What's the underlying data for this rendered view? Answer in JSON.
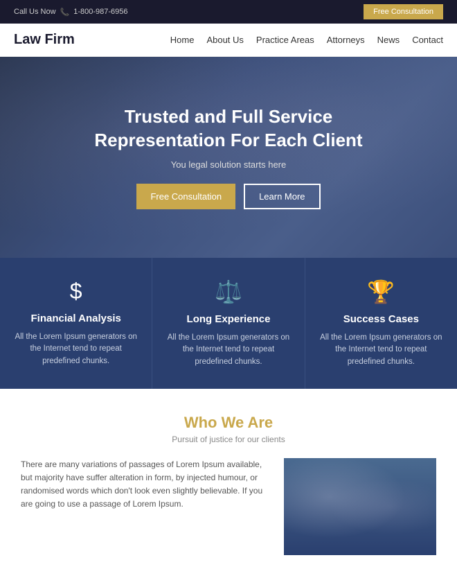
{
  "topbar": {
    "call_label": "Call Us Now",
    "phone": "1-800-987-6956",
    "cta_button": "Free Consultation"
  },
  "nav": {
    "logo": "Law Firm",
    "links": [
      {
        "label": "Home"
      },
      {
        "label": "About Us"
      },
      {
        "label": "Practice Areas"
      },
      {
        "label": "Attorneys"
      },
      {
        "label": "News"
      },
      {
        "label": "Contact"
      }
    ]
  },
  "hero": {
    "heading_line1": "Trusted and Full Service",
    "heading_line2": "Representation For Each Client",
    "subtext": "You legal solution starts here",
    "btn_primary": "Free Consultation",
    "btn_secondary": "Learn More"
  },
  "features": [
    {
      "icon": "$",
      "title": "Financial Analysis",
      "text": "All the Lorem Ipsum generators on the Internet tend to repeat predefined chunks."
    },
    {
      "icon": "⚖",
      "title": "Long Experience",
      "text": "All the Lorem Ipsum generators on the Internet tend to repeat predefined chunks."
    },
    {
      "icon": "🏆",
      "title": "Success Cases",
      "text": "All the Lorem Ipsum generators on the Internet tend to repeat predefined chunks."
    }
  ],
  "who_we_are": {
    "title": "Who We Are",
    "subtitle": "Pursuit of justice for our clients",
    "body": "There are many variations of passages of Lorem Ipsum available, but majority have suffer alteration in form, by injected humour, or randomised words which don't look even slightly believable. If you are going to use a passage of Lorem Ipsum."
  }
}
